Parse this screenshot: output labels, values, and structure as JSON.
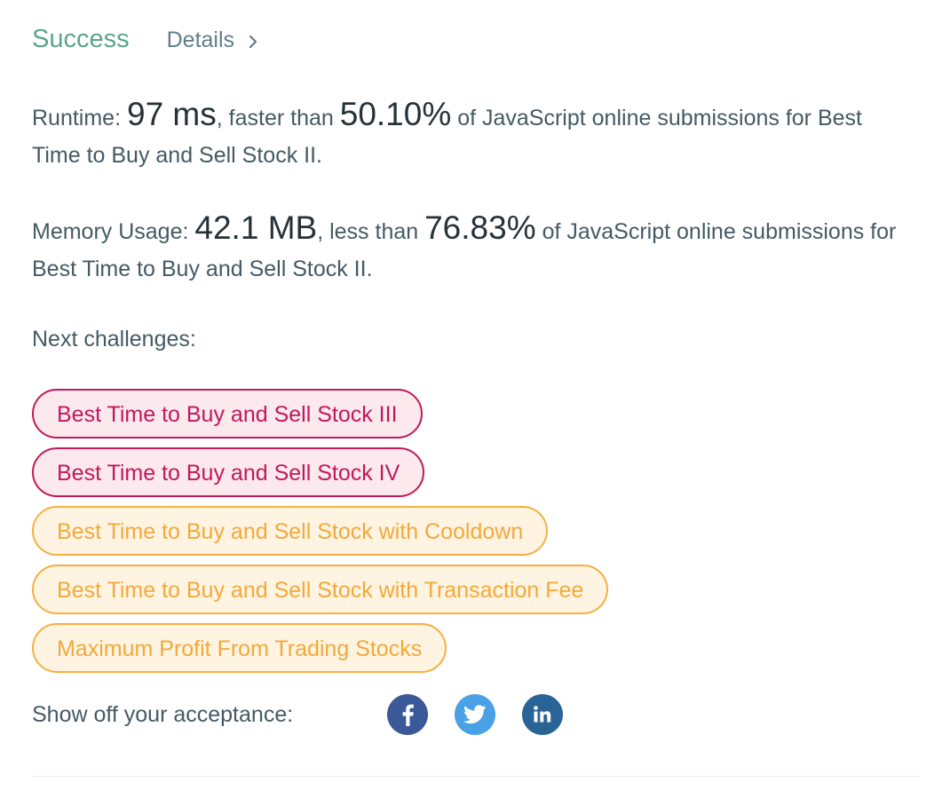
{
  "header": {
    "status": "Success",
    "details_label": "Details"
  },
  "runtime": {
    "label": "Runtime:",
    "value": "97 ms",
    "comparison": ", faster than",
    "percent": "50.10%",
    "suffix": "of JavaScript online submissions for Best Time to Buy and Sell Stock II."
  },
  "memory": {
    "label": "Memory Usage:",
    "value": "42.1 MB",
    "comparison": ", less than",
    "percent": "76.83%",
    "suffix": "of JavaScript online submissions for Best Time to Buy and Sell Stock II."
  },
  "next": {
    "label": "Next challenges:",
    "items": [
      {
        "title": "Best Time to Buy and Sell Stock III",
        "difficulty": "hard"
      },
      {
        "title": "Best Time to Buy and Sell Stock IV",
        "difficulty": "hard"
      },
      {
        "title": "Best Time to Buy and Sell Stock with Cooldown",
        "difficulty": "medium"
      },
      {
        "title": "Best Time to Buy and Sell Stock with Transaction Fee",
        "difficulty": "medium"
      },
      {
        "title": "Maximum Profit From Trading Stocks",
        "difficulty": "medium"
      }
    ]
  },
  "share": {
    "label": "Show off your acceptance:",
    "icons": [
      "facebook-icon",
      "twitter-icon",
      "linkedin-icon"
    ]
  },
  "colors": {
    "success": "#5aa58d",
    "hard": "#c2185b",
    "medium": "#f2a93b"
  }
}
